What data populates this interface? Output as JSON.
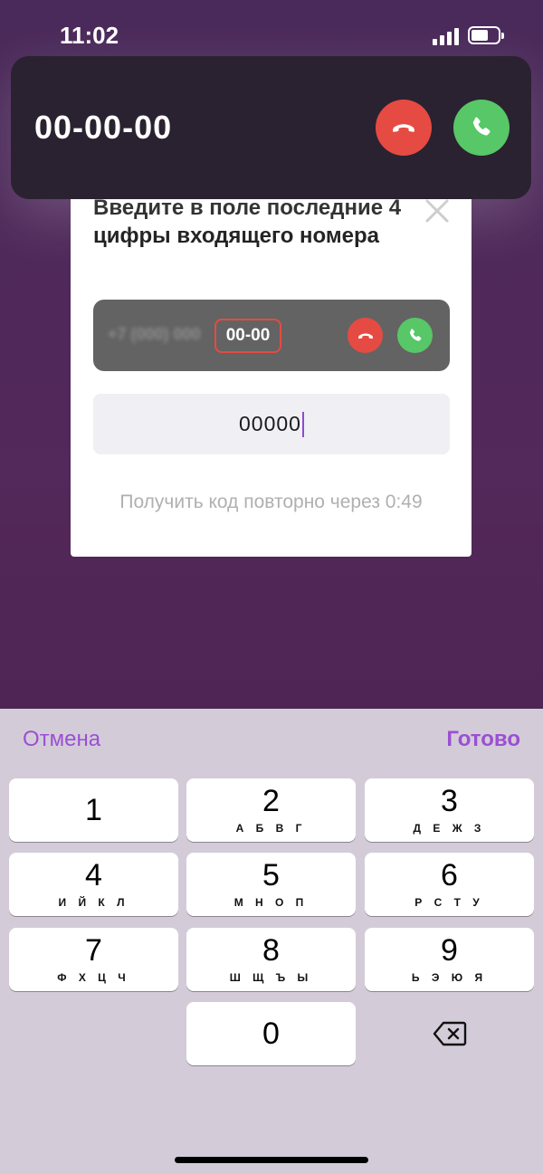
{
  "status_bar": {
    "time": "11:02"
  },
  "call_banner": {
    "number": "00-00-00"
  },
  "dialog": {
    "title": "Введите в поле последние 4 цифры входящего номера",
    "mini_call": {
      "blurred_number": "+7 (000) 000",
      "highlight_digits": "00-00"
    },
    "input": {
      "value": "00000"
    },
    "resend_text": "Получить код повторно через 0:49"
  },
  "keyboard": {
    "cancel_label": "Отмена",
    "done_label": "Готово",
    "keys": [
      {
        "digit": "1",
        "letters": ""
      },
      {
        "digit": "2",
        "letters": "А Б В Г"
      },
      {
        "digit": "3",
        "letters": "Д Е Ж З"
      },
      {
        "digit": "4",
        "letters": "И Й К Л"
      },
      {
        "digit": "5",
        "letters": "М Н О П"
      },
      {
        "digit": "6",
        "letters": "Р С Т У"
      },
      {
        "digit": "7",
        "letters": "Ф Х Ц Ч"
      },
      {
        "digit": "8",
        "letters": "Ш Щ Ъ Ы"
      },
      {
        "digit": "9",
        "letters": "Ь Э Ю Я"
      },
      {
        "digit": "0",
        "letters": ""
      }
    ]
  },
  "icons": [
    "signal-icon",
    "battery-icon",
    "decline-call-icon",
    "accept-call-icon",
    "close-icon",
    "backspace-icon"
  ],
  "colors": {
    "decline": "#e54b43",
    "accept": "#57c767",
    "accent": "#9b4fd4"
  }
}
